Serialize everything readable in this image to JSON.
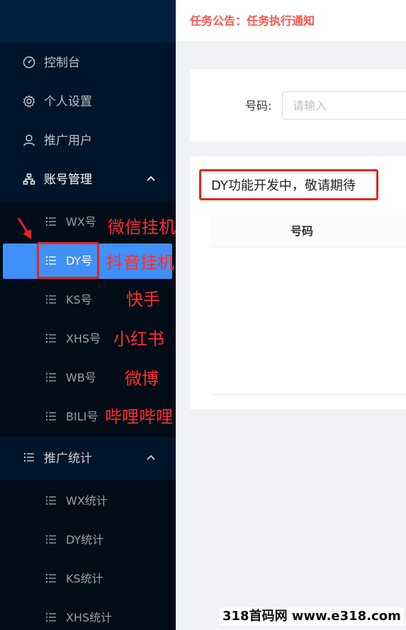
{
  "header": {
    "notice": "任务公告：任务执行通知"
  },
  "sidebar": {
    "items": [
      {
        "label": "控制台",
        "icon": "dashboard-icon"
      },
      {
        "label": "个人设置",
        "icon": "gear-icon"
      },
      {
        "label": "推广用户",
        "icon": "user-icon"
      },
      {
        "label": "账号管理",
        "icon": "cluster-icon",
        "expanded": true,
        "children": [
          "WX号",
          "DY号",
          "KS号",
          "XHS号",
          "WB号",
          "BILI号"
        ],
        "active_child": "DY号"
      },
      {
        "label": "推广统计",
        "icon": "list-icon",
        "expanded": true,
        "children": [
          "WX统计",
          "DY统计",
          "KS统计",
          "XHS统计"
        ]
      }
    ]
  },
  "annotations": [
    "微信挂机",
    "抖音挂机",
    "快手",
    "小红书",
    "微博",
    "哔哩哔哩"
  ],
  "search": {
    "label": "号码:",
    "placeholder": "请输入"
  },
  "table": {
    "message": "DY功能开发中，敬请期待",
    "columns": [
      "号码"
    ]
  },
  "watermark": "318首码网 www.e318.com",
  "colors": {
    "sidebar_bg": "#001529",
    "submenu_bg": "#000c17",
    "active": "#4090f7",
    "notice": "#f5564b",
    "annotation": "#ff2e2e"
  }
}
